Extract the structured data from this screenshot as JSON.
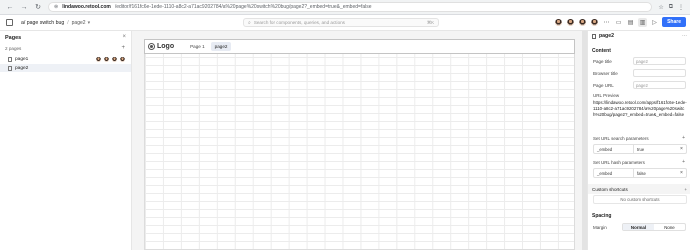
{
  "browser": {
    "url_host": "lindawoo.retool.com",
    "url_path": "/editor/f161fc6e-1ede-1110-a8c2-a71ac9202784/a%20page%20switch%20bug/page2?_embed=true&_embed=false"
  },
  "header": {
    "app_name": "a/ page switch bug",
    "separator": "/",
    "current_page": "page2",
    "search_placeholder": "Search for components, queries, and actions",
    "search_shortcut": "⌘K",
    "share_label": "Share"
  },
  "left_panel": {
    "title": "Pages",
    "pages_count": "2 pages",
    "pages": [
      {
        "label": "page1",
        "selected": false
      },
      {
        "label": "page2",
        "selected": true
      }
    ]
  },
  "canvas": {
    "logo_text": "Logo",
    "nav_tabs": [
      {
        "label": "Page 1",
        "active": false
      },
      {
        "label": "page2",
        "active": true
      }
    ]
  },
  "right_panel": {
    "title": "page2",
    "content_section": "Content",
    "page_title_label": "Page title",
    "page_title_value": "page2",
    "browser_title_label": "Browser title",
    "page_url_label": "Page URL",
    "page_url_value": "page2",
    "url_preview_label": "URL Preview",
    "url_preview": "https://lindawoo.retool.com/apps/f161fc6e-1ede-1110-a8c2-a71ac9202784/a%20page%20switch%20bug/page2?_embed=true&_embed=false",
    "search_params_label": "Set URL search parameters",
    "search_param": {
      "key": "_embed",
      "value": "true"
    },
    "hash_params_label": "Set URL hash parameters",
    "hash_param": {
      "key": "_embed",
      "value": "false"
    },
    "custom_shortcuts_label": "Custom shortcuts",
    "no_shortcuts": "No custom shortcuts",
    "spacing_section": "Spacing",
    "margin_label": "Margin",
    "margin_options": [
      "Normal",
      "None"
    ]
  },
  "colors": {
    "accent": "#3170f9",
    "selected_bg": "#eef1f6"
  }
}
